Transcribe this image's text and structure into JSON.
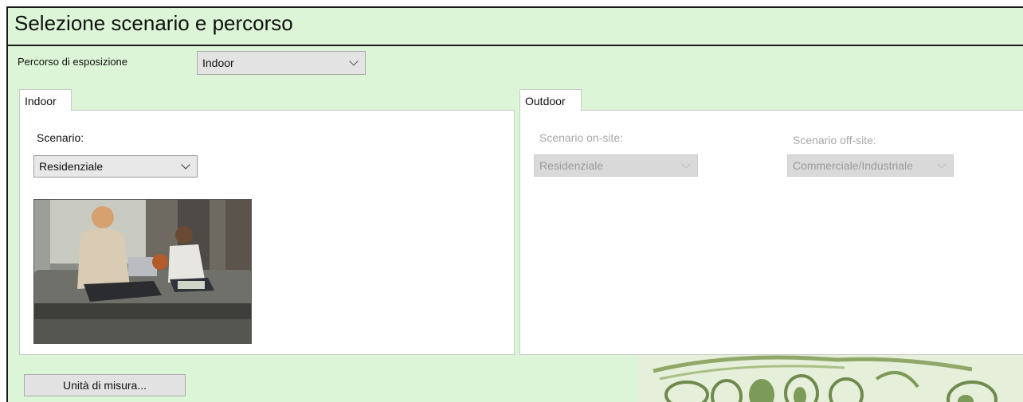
{
  "header": {
    "title": "Selezione scenario e percorso"
  },
  "exposure_path": {
    "label": "Percorso di esposizione",
    "value": "Indoor"
  },
  "indoor": {
    "tab_label": "Indoor",
    "scenario_label": "Scenario:",
    "scenario_value": "Residenziale"
  },
  "outdoor": {
    "tab_label": "Outdoor",
    "onsite_label": "Scenario on-site:",
    "onsite_value": "Residenziale",
    "offsite_label": "Scenario off-site:",
    "offsite_value": "Commerciale/Industriale"
  },
  "units_button": {
    "label": "Unità di misura..."
  },
  "colors": {
    "background": "#dcf5d6",
    "panel": "#ffffff",
    "disabled_text": "#a8a8a8"
  }
}
